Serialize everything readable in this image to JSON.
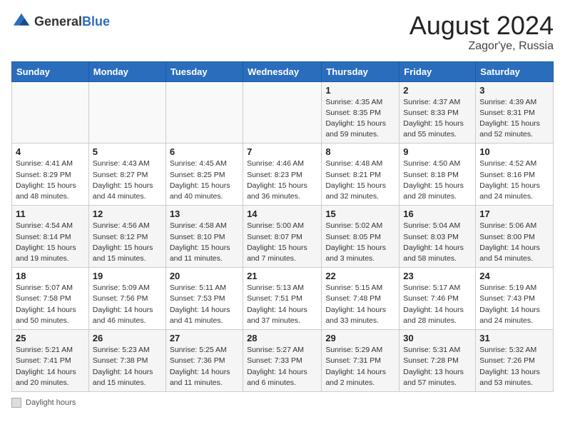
{
  "header": {
    "logo_general": "General",
    "logo_blue": "Blue",
    "month_year": "August 2024",
    "location": "Zagor'ye, Russia"
  },
  "footer": {
    "label": "Daylight hours"
  },
  "days_of_week": [
    "Sunday",
    "Monday",
    "Tuesday",
    "Wednesday",
    "Thursday",
    "Friday",
    "Saturday"
  ],
  "weeks": [
    {
      "days": [
        {
          "number": "",
          "info": ""
        },
        {
          "number": "",
          "info": ""
        },
        {
          "number": "",
          "info": ""
        },
        {
          "number": "",
          "info": ""
        },
        {
          "number": "1",
          "info": "Sunrise: 4:35 AM\nSunset: 8:35 PM\nDaylight: 15 hours\nand 59 minutes."
        },
        {
          "number": "2",
          "info": "Sunrise: 4:37 AM\nSunset: 8:33 PM\nDaylight: 15 hours\nand 55 minutes."
        },
        {
          "number": "3",
          "info": "Sunrise: 4:39 AM\nSunset: 8:31 PM\nDaylight: 15 hours\nand 52 minutes."
        }
      ]
    },
    {
      "days": [
        {
          "number": "4",
          "info": "Sunrise: 4:41 AM\nSunset: 8:29 PM\nDaylight: 15 hours\nand 48 minutes."
        },
        {
          "number": "5",
          "info": "Sunrise: 4:43 AM\nSunset: 8:27 PM\nDaylight: 15 hours\nand 44 minutes."
        },
        {
          "number": "6",
          "info": "Sunrise: 4:45 AM\nSunset: 8:25 PM\nDaylight: 15 hours\nand 40 minutes."
        },
        {
          "number": "7",
          "info": "Sunrise: 4:46 AM\nSunset: 8:23 PM\nDaylight: 15 hours\nand 36 minutes."
        },
        {
          "number": "8",
          "info": "Sunrise: 4:48 AM\nSunset: 8:21 PM\nDaylight: 15 hours\nand 32 minutes."
        },
        {
          "number": "9",
          "info": "Sunrise: 4:50 AM\nSunset: 8:18 PM\nDaylight: 15 hours\nand 28 minutes."
        },
        {
          "number": "10",
          "info": "Sunrise: 4:52 AM\nSunset: 8:16 PM\nDaylight: 15 hours\nand 24 minutes."
        }
      ]
    },
    {
      "days": [
        {
          "number": "11",
          "info": "Sunrise: 4:54 AM\nSunset: 8:14 PM\nDaylight: 15 hours\nand 19 minutes."
        },
        {
          "number": "12",
          "info": "Sunrise: 4:56 AM\nSunset: 8:12 PM\nDaylight: 15 hours\nand 15 minutes."
        },
        {
          "number": "13",
          "info": "Sunrise: 4:58 AM\nSunset: 8:10 PM\nDaylight: 15 hours\nand 11 minutes."
        },
        {
          "number": "14",
          "info": "Sunrise: 5:00 AM\nSunset: 8:07 PM\nDaylight: 15 hours\nand 7 minutes."
        },
        {
          "number": "15",
          "info": "Sunrise: 5:02 AM\nSunset: 8:05 PM\nDaylight: 15 hours\nand 3 minutes."
        },
        {
          "number": "16",
          "info": "Sunrise: 5:04 AM\nSunset: 8:03 PM\nDaylight: 14 hours\nand 58 minutes."
        },
        {
          "number": "17",
          "info": "Sunrise: 5:06 AM\nSunset: 8:00 PM\nDaylight: 14 hours\nand 54 minutes."
        }
      ]
    },
    {
      "days": [
        {
          "number": "18",
          "info": "Sunrise: 5:07 AM\nSunset: 7:58 PM\nDaylight: 14 hours\nand 50 minutes."
        },
        {
          "number": "19",
          "info": "Sunrise: 5:09 AM\nSunset: 7:56 PM\nDaylight: 14 hours\nand 46 minutes."
        },
        {
          "number": "20",
          "info": "Sunrise: 5:11 AM\nSunset: 7:53 PM\nDaylight: 14 hours\nand 41 minutes."
        },
        {
          "number": "21",
          "info": "Sunrise: 5:13 AM\nSunset: 7:51 PM\nDaylight: 14 hours\nand 37 minutes."
        },
        {
          "number": "22",
          "info": "Sunrise: 5:15 AM\nSunset: 7:48 PM\nDaylight: 14 hours\nand 33 minutes."
        },
        {
          "number": "23",
          "info": "Sunrise: 5:17 AM\nSunset: 7:46 PM\nDaylight: 14 hours\nand 28 minutes."
        },
        {
          "number": "24",
          "info": "Sunrise: 5:19 AM\nSunset: 7:43 PM\nDaylight: 14 hours\nand 24 minutes."
        }
      ]
    },
    {
      "days": [
        {
          "number": "25",
          "info": "Sunrise: 5:21 AM\nSunset: 7:41 PM\nDaylight: 14 hours\nand 20 minutes."
        },
        {
          "number": "26",
          "info": "Sunrise: 5:23 AM\nSunset: 7:38 PM\nDaylight: 14 hours\nand 15 minutes."
        },
        {
          "number": "27",
          "info": "Sunrise: 5:25 AM\nSunset: 7:36 PM\nDaylight: 14 hours\nand 11 minutes."
        },
        {
          "number": "28",
          "info": "Sunrise: 5:27 AM\nSunset: 7:33 PM\nDaylight: 14 hours\nand 6 minutes."
        },
        {
          "number": "29",
          "info": "Sunrise: 5:29 AM\nSunset: 7:31 PM\nDaylight: 14 hours\nand 2 minutes."
        },
        {
          "number": "30",
          "info": "Sunrise: 5:31 AM\nSunset: 7:28 PM\nDaylight: 13 hours\nand 57 minutes."
        },
        {
          "number": "31",
          "info": "Sunrise: 5:32 AM\nSunset: 7:26 PM\nDaylight: 13 hours\nand 53 minutes."
        }
      ]
    }
  ]
}
